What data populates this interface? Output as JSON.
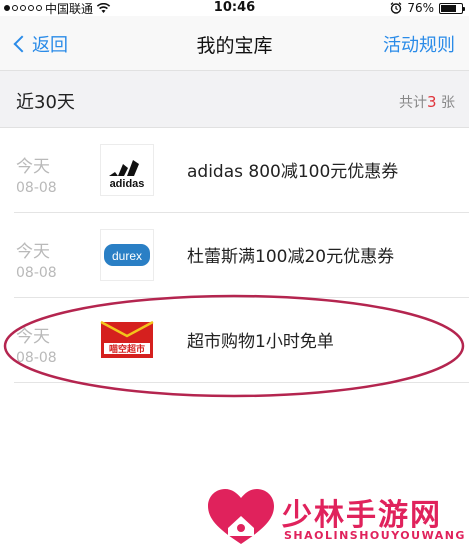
{
  "status_bar": {
    "carrier": "中国联通",
    "time": "10:46",
    "battery_text": "76%",
    "battery_level": 0.76,
    "signal_icon": "signal-dots-icon",
    "wifi_icon": "wifi-icon",
    "alarm_icon": "alarm-clock-icon"
  },
  "nav": {
    "back_label": "返回",
    "title": "我的宝库",
    "right_label": "活动规则",
    "accent": "#2a8be8"
  },
  "section": {
    "title": "近30天",
    "count_prefix": "共计",
    "count_value": "3",
    "count_suffix": " 张",
    "count_color": "#e0353c"
  },
  "items": [
    {
      "day": "今天",
      "date": "08-08",
      "brand": "adidas",
      "title": "adidas 800减100元优惠券"
    },
    {
      "day": "今天",
      "date": "08-08",
      "brand": "durex",
      "title": "杜蕾斯满100减20元优惠券"
    },
    {
      "day": "今天",
      "date": "08-08",
      "brand": "喵空超市",
      "title": "超市购物1小时免单"
    }
  ],
  "watermark": {
    "text": "少林手游网",
    "sub": "SHAOLINSHOUYOUWANG",
    "color": "#e0225c"
  }
}
